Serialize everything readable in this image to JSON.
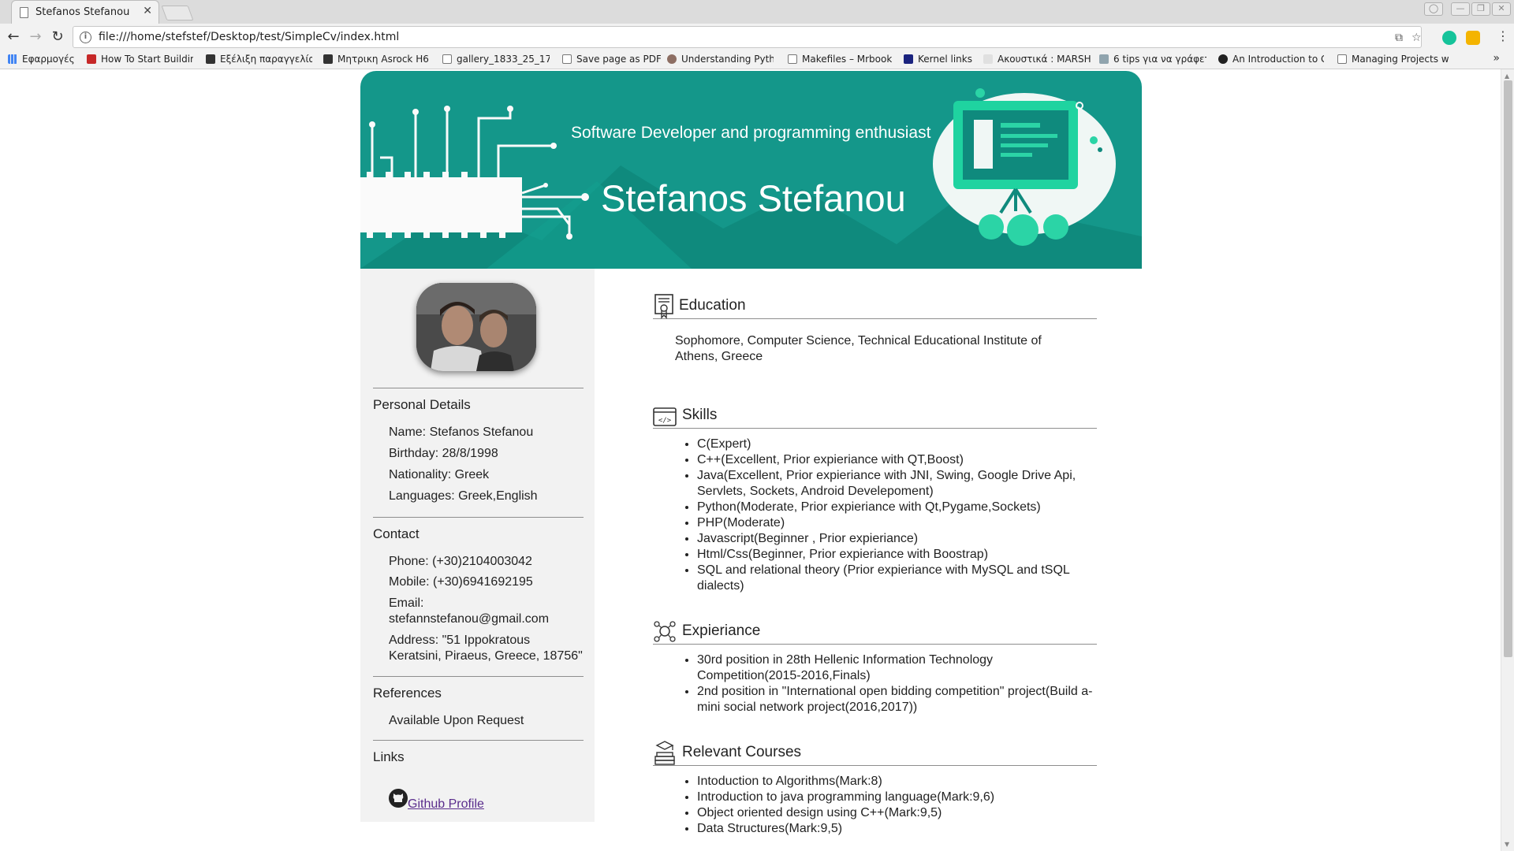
{
  "browser": {
    "tab_title": "Stefanos Stefanou",
    "url": "file:///home/stefstef/Desktop/test/SimpleCv/index.html",
    "bookmarks": [
      "Εφαρμογές",
      "How To Start Buildin",
      "Εξέλιξη παραγγελία",
      "Μητρικη Asrock H6",
      "gallery_1833_25_17:",
      "Save page as PDF",
      "Understanding Pyth",
      "Makefiles – Mrbook",
      "Kernel links",
      "Ακουστικά : MARSH",
      "6 tips για να γράφετ",
      "An Introduction to G",
      "Managing Projects w"
    ]
  },
  "banner": {
    "tagline": "Software Developer and programming enthusiast",
    "name": "Stefanos Stefanou",
    "colors": {
      "background": "#14978a",
      "accent": "#2bd4a6"
    }
  },
  "sidebar": {
    "personal": {
      "heading": "Personal Details",
      "items": [
        "Name: Stefanos Stefanou",
        "Birthday: 28/8/1998",
        "Nationality: Greek",
        "Languages: Greek,English"
      ]
    },
    "contact": {
      "heading": "Contact",
      "phone": "Phone: (+30)2104003042",
      "mobile": "Mobile: (+30)6941692195",
      "email_label": "Email:",
      "email": "stefannstefanou@gmail.com",
      "address": "Address: \"51 Ippokratous Keratsini, Piraeus, Greece, 18756\""
    },
    "references": {
      "heading": "References",
      "text": "Available Upon Request"
    },
    "links": {
      "heading": "Links",
      "github": "Github Profile"
    }
  },
  "main": {
    "education": {
      "title": "Education",
      "text": "Sophomore, Computer Science, Technical Educational Institute of Athens, Greece"
    },
    "skills": {
      "title": "Skills",
      "items": [
        "C(Expert)",
        "C++(Excellent, Prior expieriance with QT,Boost)",
        "Java(Excellent, Prior expieriance with JNI, Swing, Google Drive Api, Servlets, Sockets, Android Develepoment)",
        "Python(Moderate, Prior expieriance with Qt,Pygame,Sockets)",
        "PHP(Moderate)",
        "Javascript(Beginner , Prior expieriance)",
        "Html/Css(Beginner, Prior expieriance with Boostrap)",
        "SQL and relational theory (Prior expieriance with MySQL and tSQL dialects)"
      ]
    },
    "experience": {
      "title": "Expieriance",
      "items": [
        "30rd position in 28th Hellenic Information Technology Competition(2015-2016,Finals)",
        "2nd position in \"International open bidding competition\" project(Build a-mini social network project(2016,2017))"
      ]
    },
    "courses": {
      "title": "Relevant Courses",
      "items": [
        "Intoduction to Algorithms(Mark:8)",
        "Introduction to java programming language(Mark:9,6)",
        "Object oriented design using C++(Mark:9,5)",
        "Data Structures(Mark:9,5)"
      ]
    }
  }
}
